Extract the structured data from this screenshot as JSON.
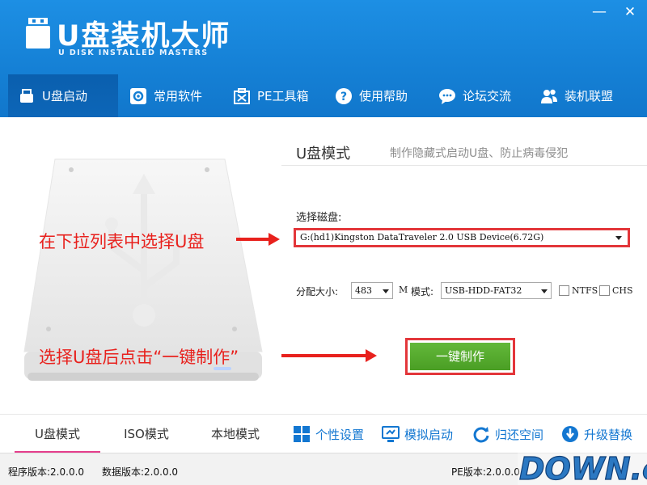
{
  "app": {
    "title": "U盘装机大师",
    "subtitle": "U DISK INSTALLED MASTERS",
    "minimize_glyph": "—",
    "close_glyph": "✕"
  },
  "nav": {
    "items": [
      {
        "label": "U盘启动",
        "icon": "usb-drive-icon",
        "active": true
      },
      {
        "label": "常用软件",
        "icon": "software-gear-icon",
        "active": false
      },
      {
        "label": "PE工具箱",
        "icon": "toolbox-icon",
        "active": false
      },
      {
        "label": "使用帮助",
        "icon": "help-question-icon",
        "active": false
      },
      {
        "label": "论坛交流",
        "icon": "chat-bubble-icon",
        "active": false
      },
      {
        "label": "装机联盟",
        "icon": "people-icon",
        "active": false
      }
    ]
  },
  "main": {
    "mode_title": "U盘模式",
    "mode_desc": "制作隐藏式启动U盘、防止病毒侵犯",
    "disk_label": "选择磁盘:",
    "disk_value": "G:(hd1)Kingston DataTraveler 2.0 USB Device(6.72G)",
    "alloc_label": "分配大小:",
    "alloc_value": "483",
    "alloc_unit": "M",
    "mode_label": "模式:",
    "mode_value": "USB-HDD-FAT32",
    "ntfs_label": "NTFS",
    "chs_label": "CHS",
    "make_button": "一键制作",
    "annotation_select": "在下拉列表中选择U盘",
    "annotation_make": "选择U盘后点击“一键制作”"
  },
  "bottom_tabs": [
    {
      "label": "U盘模式",
      "active": true
    },
    {
      "label": "ISO模式",
      "active": false
    },
    {
      "label": "本地模式",
      "active": false
    }
  ],
  "tools": [
    {
      "label": "个性设置",
      "icon": "grid-settings-icon"
    },
    {
      "label": "模拟启动",
      "icon": "monitor-icon"
    },
    {
      "label": "归还空间",
      "icon": "refresh-icon"
    },
    {
      "label": "升级替换",
      "icon": "download-icon"
    }
  ],
  "status": {
    "program_version": "程序版本:2.0.0.0",
    "data_version": "数据版本:2.0.0.0",
    "pe_version": "PE版本:2.0.0.0"
  },
  "watermark": {
    "text": "DOWN.cc"
  },
  "colors": {
    "header_blue": "#1580d5",
    "accent_red": "#e3363a",
    "button_green": "#4a9e24",
    "tool_blue": "#1377d1",
    "tab_pink": "#e53e8c"
  }
}
